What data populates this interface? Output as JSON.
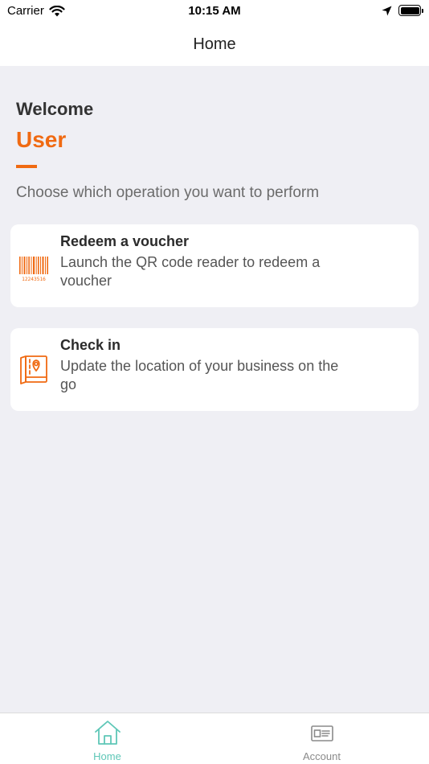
{
  "status_bar": {
    "carrier": "Carrier",
    "time": "10:15 AM"
  },
  "nav": {
    "title": "Home"
  },
  "welcome": {
    "label": "Welcome",
    "user_name": "User",
    "subtitle": "Choose which operation you want to perform"
  },
  "cards": [
    {
      "title": "Redeem a voucher",
      "description": "Launch the QR code reader to redeem a voucher",
      "icon": "barcode-icon",
      "barcode_number": "12243516"
    },
    {
      "title": "Check in",
      "description": "Update the location of your business on the go",
      "icon": "map-pin-icon"
    }
  ],
  "tab_bar": {
    "items": [
      {
        "label": "Home",
        "icon": "home-icon",
        "active": true
      },
      {
        "label": "Account",
        "icon": "id-card-icon",
        "active": false
      }
    ]
  },
  "colors": {
    "accent": "#f06a12",
    "tab_active": "#5ec7b7",
    "tab_inactive": "#8a8a8a",
    "background": "#efeff4"
  }
}
